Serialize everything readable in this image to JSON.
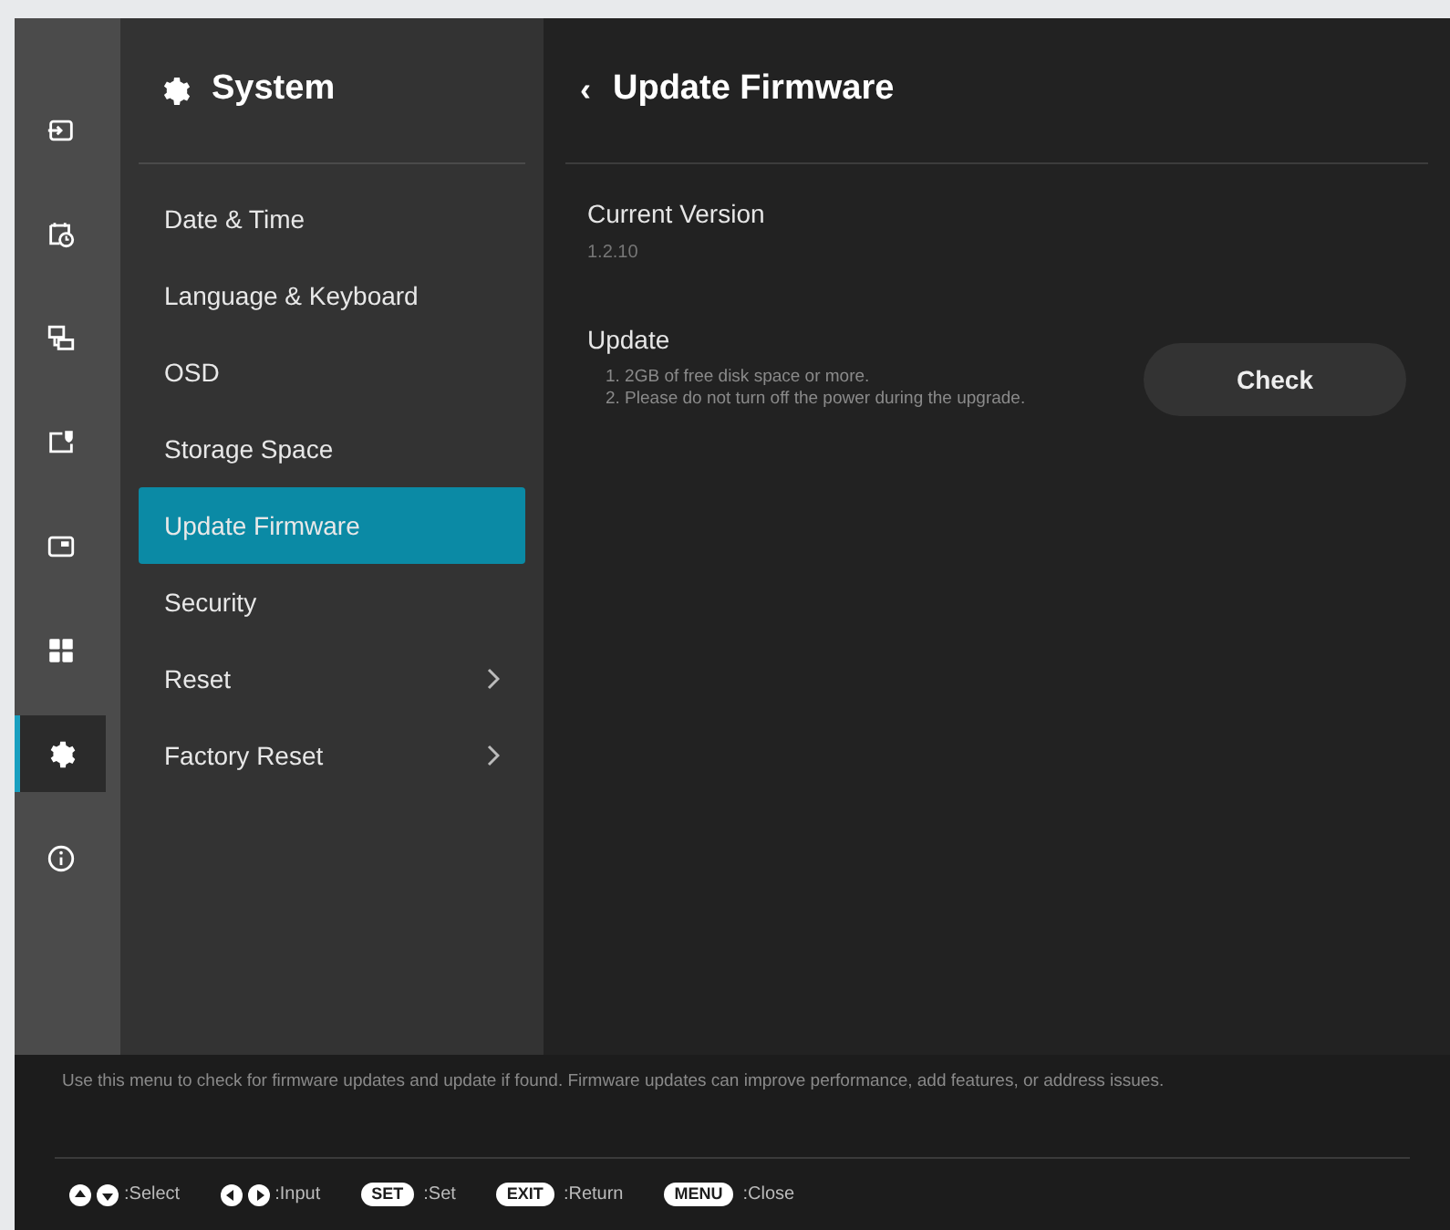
{
  "rail": [
    {
      "kind": "input",
      "selected": false
    },
    {
      "kind": "schedule",
      "selected": false
    },
    {
      "kind": "network",
      "selected": false
    },
    {
      "kind": "display",
      "selected": false
    },
    {
      "kind": "screen",
      "selected": false
    },
    {
      "kind": "apps",
      "selected": false
    },
    {
      "kind": "system",
      "selected": true
    },
    {
      "kind": "info",
      "selected": false
    }
  ],
  "menu": {
    "title": "System",
    "items": [
      {
        "label": "Date & Time",
        "selected": false,
        "submenu": false
      },
      {
        "label": "Language & Keyboard",
        "selected": false,
        "submenu": false
      },
      {
        "label": "OSD",
        "selected": false,
        "submenu": false
      },
      {
        "label": "Storage Space",
        "selected": false,
        "submenu": false
      },
      {
        "label": "Update Firmware",
        "selected": true,
        "submenu": false
      },
      {
        "label": "Security",
        "selected": false,
        "submenu": false
      },
      {
        "label": "Reset",
        "selected": false,
        "submenu": true
      },
      {
        "label": "Factory Reset",
        "selected": false,
        "submenu": true
      }
    ]
  },
  "content": {
    "back": "‹",
    "title": "Update Firmware",
    "current_version": {
      "label": "Current Version",
      "value": "1.2.10"
    },
    "update": {
      "label": "Update",
      "notes": [
        "1. 2GB of free disk space or more.",
        "2. Please do not turn off the power during the upgrade."
      ],
      "button": "Check"
    }
  },
  "description": "Use this menu to check for firmware updates and update if found. Firmware updates can improve performance, add features, or address issues.",
  "hints": [
    {
      "kind": "updown",
      "label": ":Select"
    },
    {
      "kind": "leftright",
      "label": ":Input"
    },
    {
      "kind": "key",
      "key": "SET",
      "label": ":Set"
    },
    {
      "kind": "key",
      "key": "EXIT",
      "label": ":Return"
    },
    {
      "kind": "key",
      "key": "MENU",
      "label": ":Close"
    }
  ]
}
